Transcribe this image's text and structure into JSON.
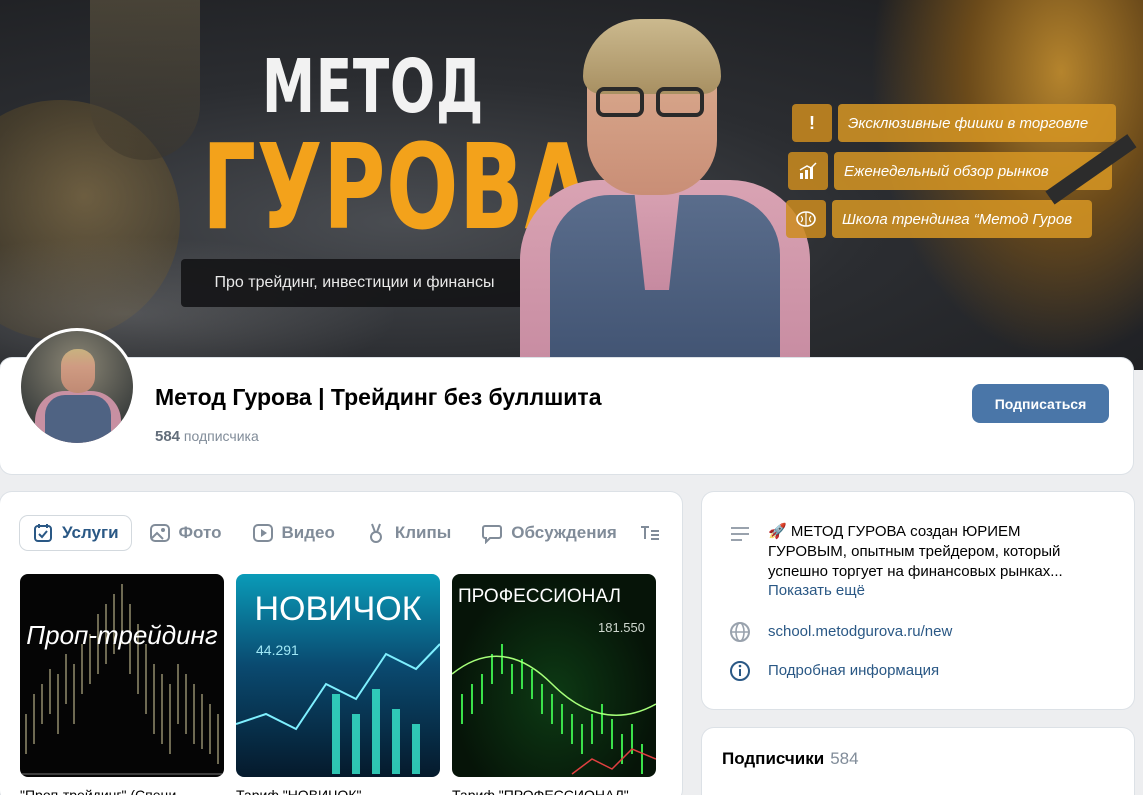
{
  "cover": {
    "title_line1": "МЕТОД",
    "title_line2": "ГУРОВА",
    "tagline": "Про трейдинг, инвестиции и финансы",
    "features": [
      {
        "icon": "exclamation-icon",
        "glyph": "!",
        "label": "Эксклюзивные фишки в торговле"
      },
      {
        "icon": "bar-chart-icon",
        "glyph": "",
        "label": "Еженедельный обзор рынков"
      },
      {
        "icon": "brain-icon",
        "glyph": "",
        "label": "Школа трендинга “Метод Гуров"
      }
    ]
  },
  "header": {
    "title": "Метод Гурова | Трейдинг без буллшита",
    "subscribers_count": "584",
    "subscribers_label": "подписчика",
    "subscribe_label": "Подписаться"
  },
  "tabs": [
    {
      "label": "Услуги",
      "icon": "calendar-check-icon",
      "active": true
    },
    {
      "label": "Фото",
      "icon": "photo-icon",
      "active": false
    },
    {
      "label": "Видео",
      "icon": "video-icon",
      "active": false
    },
    {
      "label": "Клипы",
      "icon": "clips-icon",
      "active": false
    },
    {
      "label": "Обсуждения",
      "icon": "chat-icon",
      "active": false
    }
  ],
  "products": [
    {
      "thumb_text": "Проп-трейдинг",
      "title": "\"Проп-трейдинг\" (Специ..."
    },
    {
      "thumb_text": "НОВИЧОК",
      "thumb_number": "44.291",
      "title": "Тариф \"НОВИЧОК\""
    },
    {
      "thumb_text": "ПРОФЕССИОНАЛ",
      "thumb_number": "181.550",
      "title": "Тариф \"ПРОФЕССИОНАЛ\""
    }
  ],
  "info": {
    "description": "🚀 МЕТОД ГУРОВА создан ЮРИЕМ ГУРОВЫМ, опытным трейдером, который успешно торгует на финансовых рынках...",
    "show_more": "Показать ещё",
    "website": "school.metodgurova.ru/new",
    "details": "Подробная информация"
  },
  "followers": {
    "label": "Подписчики",
    "count": "584"
  },
  "colors": {
    "accent": "#4a76a8",
    "link": "#2a5885",
    "gold": "#f3a21b",
    "muted": "#818c99"
  }
}
